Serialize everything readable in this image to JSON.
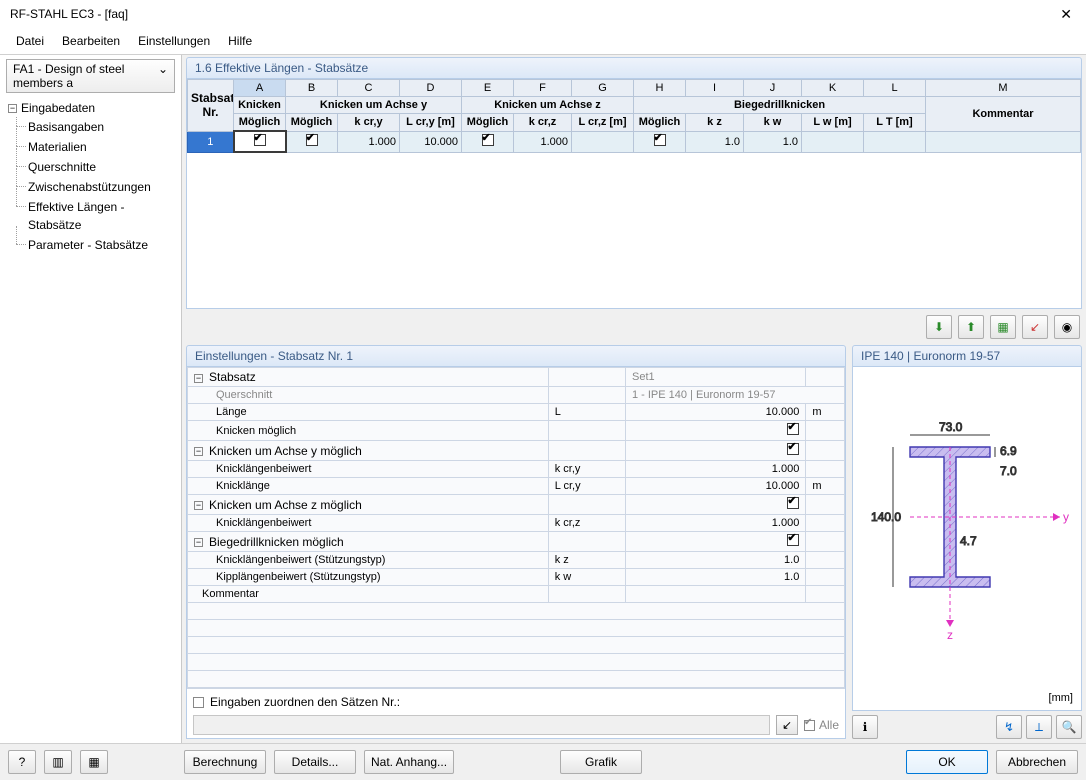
{
  "window": {
    "title": "RF-STAHL EC3 - [faq]"
  },
  "menu": {
    "file": "Datei",
    "edit": "Bearbeiten",
    "settings": "Einstellungen",
    "help": "Hilfe"
  },
  "fa_selector": "FA1 - Design of steel members a",
  "tree": {
    "root": "Eingabedaten",
    "items": [
      "Basisangaben",
      "Materialien",
      "Querschnitte",
      "Zwischenabstützungen",
      "Effektive Längen - Stabsätze",
      "Parameter - Stabsätze"
    ]
  },
  "section_header": "1.6 Effektive Längen - Stabsätze",
  "cols": {
    "stabsatz": "Stabsatz",
    "nr": "Nr.",
    "letters": [
      "A",
      "B",
      "C",
      "D",
      "E",
      "F",
      "G",
      "H",
      "I",
      "J",
      "K",
      "L",
      "M"
    ],
    "knicken": "Knicken",
    "knicken_y": "Knicken um Achse y",
    "knicken_z": "Knicken um Achse z",
    "biegedrill": "Biegedrillknicken",
    "moeglich": "Möglich",
    "kcry": "k cr,y",
    "lcry": "L cr,y [m]",
    "kcrz": "k cr,z",
    "lcrz": "L cr,z [m]",
    "kz": "k z",
    "kw": "k w",
    "lw": "L w [m]",
    "lt": "L T [m]",
    "kommentar": "Kommentar"
  },
  "row1": {
    "nr": "1",
    "kn": true,
    "kny": true,
    "kcry": "1.000",
    "lcry": "10.000",
    "knz": true,
    "kcrz": "1.000",
    "lcrz": "",
    "bdk": true,
    "kz": "1.0",
    "kw": "1.0",
    "lw": "",
    "lt": "",
    "komm": ""
  },
  "props_title": "Einstellungen - Stabsatz Nr. 1",
  "props": {
    "stabsatz": "Stabsatz",
    "set1": "Set1",
    "querschnitt": "Querschnitt",
    "qs_val": "1 - IPE 140 | Euronorm 19-57",
    "laenge": "Länge",
    "L": "L",
    "laenge_val": "10.000",
    "laenge_unit": "m",
    "knick_m": "Knicken möglich",
    "knick_y": "Knicken um Achse y möglich",
    "klb": "Knicklängenbeiwert",
    "kcry_lbl": "k cr,y",
    "kcry_val": "1.000",
    "kl": "Knicklänge",
    "lcry_lbl": "L cr,y",
    "lcry_val": "10.000",
    "lcry_unit": "m",
    "knick_z": "Knicken um Achse z möglich",
    "kcrz_lbl": "k cr,z",
    "kcrz_val": "1.000",
    "bdk": "Biegedrillknicken möglich",
    "klb_s": "Knicklängenbeiwert (Stützungstyp)",
    "kz_lbl": "k z",
    "kz_val": "1.0",
    "kipp": "Kipplängenbeiwert (Stützungstyp)",
    "kw_lbl": "k w",
    "kw_val": "1.0",
    "kommentar": "Kommentar"
  },
  "assign": {
    "label": "Eingaben zuordnen den Sätzen Nr.:",
    "alle": "Alle"
  },
  "section": {
    "title": "IPE 140 | Euronorm 19-57",
    "unit": "[mm]",
    "dims": {
      "b": "73.0",
      "h": "140.0",
      "tf": "6.9",
      "tw": "4.7",
      "r": "7.0"
    }
  },
  "buttons": {
    "berechnung": "Berechnung",
    "details": "Details...",
    "nat": "Nat. Anhang...",
    "grafik": "Grafik",
    "ok": "OK",
    "abbrechen": "Abbrechen"
  }
}
